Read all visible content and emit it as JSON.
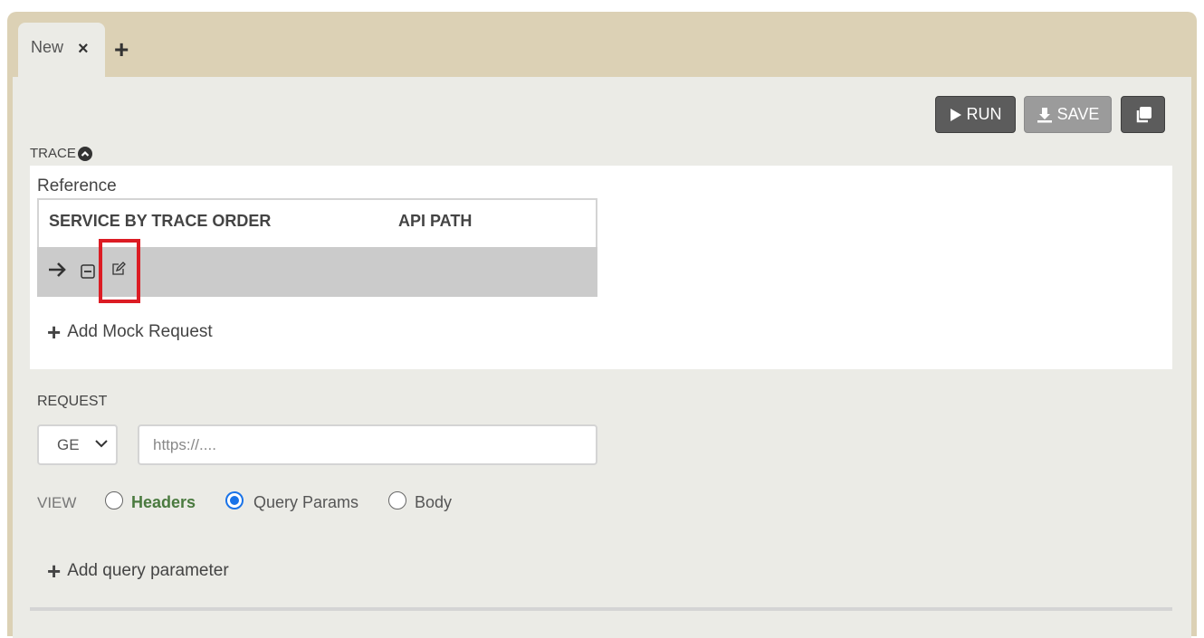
{
  "tabs": [
    {
      "label": "New",
      "close_icon": "×",
      "active": true
    }
  ],
  "add_tab_icon": "+",
  "toolbar": {
    "run_label": "RUN",
    "save_label": "SAVE"
  },
  "trace": {
    "label": "TRACE",
    "reference_label": "Reference",
    "columns": [
      "SERVICE BY TRACE ORDER",
      "API PATH"
    ],
    "add_mock_label": "Add Mock Request"
  },
  "request": {
    "label": "REQUEST",
    "method_value": "GE",
    "url_placeholder": "https://...."
  },
  "view": {
    "label": "VIEW",
    "options": [
      "Headers",
      "Query Params",
      "Body"
    ],
    "selected": "Query Params"
  },
  "add_param_label": "Add query parameter",
  "colors": {
    "frame": "#dcd1b5",
    "panel": "#ebebe6",
    "highlight": "#dc1c24",
    "radio_selected": "#1a73e8",
    "headers_label": "#4a7a3f"
  },
  "icons": [
    "close-icon",
    "plus-icon",
    "play-icon",
    "download-icon",
    "copy-icon",
    "chevron-up-circle-icon",
    "arrow-right-icon",
    "minus-square-icon",
    "edit-icon",
    "chevron-down-icon"
  ]
}
